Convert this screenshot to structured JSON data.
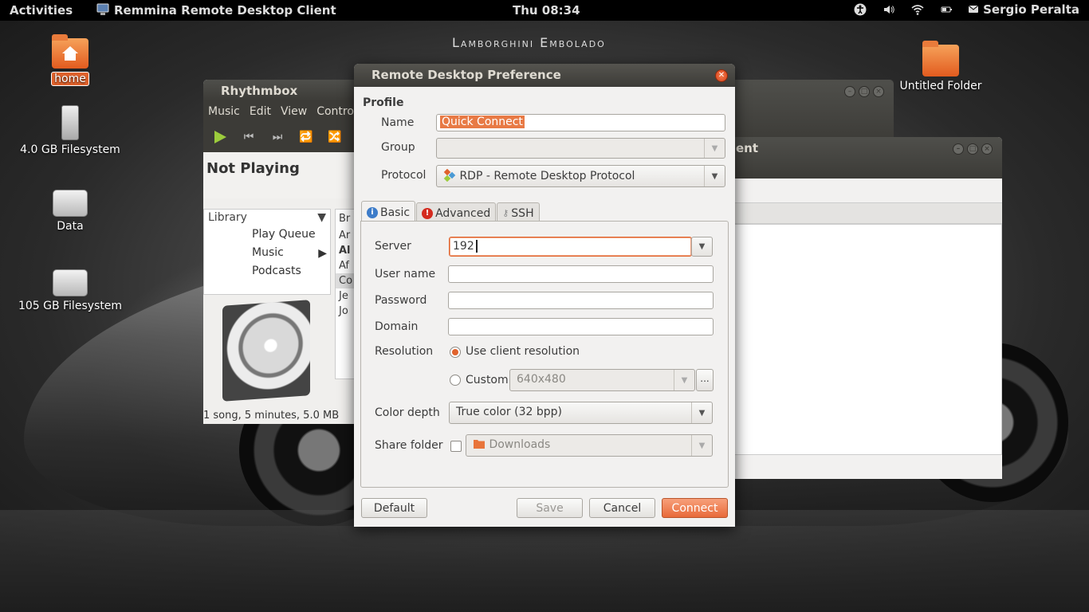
{
  "top_panel": {
    "activities": "Activities",
    "app_title": "Remmina Remote Desktop Client",
    "clock": "Thu 08:34",
    "user": "Sergio Peralta",
    "tray_icons": [
      "accessibility-icon",
      "volume-icon",
      "wifi-icon",
      "battery-icon"
    ]
  },
  "desktop": {
    "wallpaper_title": "Lamborghini Embolado",
    "icons": [
      {
        "label": "home",
        "icon": "home-folder-icon"
      },
      {
        "label": "4.0 GB Filesystem",
        "icon": "usb-drive-icon"
      },
      {
        "label": "Data",
        "icon": "hard-drive-icon"
      },
      {
        "label": "105 GB Filesystem",
        "icon": "hard-drive-icon"
      },
      {
        "label": "Untitled Folder",
        "icon": "folder-icon"
      }
    ]
  },
  "rhythmbox": {
    "title": "Rhythmbox",
    "menu": [
      "Music",
      "Edit",
      "View",
      "Control"
    ],
    "now_playing": "Not Playing",
    "library_header": "Library",
    "items": [
      "Play Queue",
      "Music",
      "Podcasts"
    ],
    "right_col_fragments": [
      "Br",
      "Ar",
      "Al",
      "Af",
      "Co",
      "Je",
      "Jo"
    ],
    "status": "1 song, 5 minutes, 5.0 MB"
  },
  "bg_window": {
    "title_fragment": "ent"
  },
  "dialog": {
    "title": "Remote Desktop Preference",
    "profile_heading": "Profile",
    "name_label": "Name",
    "name_value": "Quick Connect",
    "group_label": "Group",
    "group_value": "",
    "protocol_label": "Protocol",
    "protocol_value": "RDP - Remote Desktop Protocol",
    "tabs": [
      {
        "label": "Basic",
        "icon": "info-icon",
        "active": true
      },
      {
        "label": "Advanced",
        "icon": "warning-icon",
        "active": false
      },
      {
        "label": "SSH",
        "icon": "key-icon",
        "active": false
      }
    ],
    "server_label": "Server",
    "server_value": "192",
    "username_label": "User name",
    "username_value": "",
    "password_label": "Password",
    "password_value": "",
    "domain_label": "Domain",
    "domain_value": "",
    "resolution_label": "Resolution",
    "resolution_client": "Use client resolution",
    "resolution_custom": "Custom",
    "resolution_custom_value": "640x480",
    "resolution_ellipsis": "...",
    "color_depth_label": "Color depth",
    "color_depth_value": "True color (32 bpp)",
    "share_folder_label": "Share folder",
    "share_folder_value": "Downloads",
    "buttons": {
      "default": "Default",
      "save": "Save",
      "cancel": "Cancel",
      "connect": "Connect"
    }
  },
  "colors": {
    "accent": "#e0622c",
    "titlebar": "#3c3b37",
    "panel": "#000000"
  }
}
